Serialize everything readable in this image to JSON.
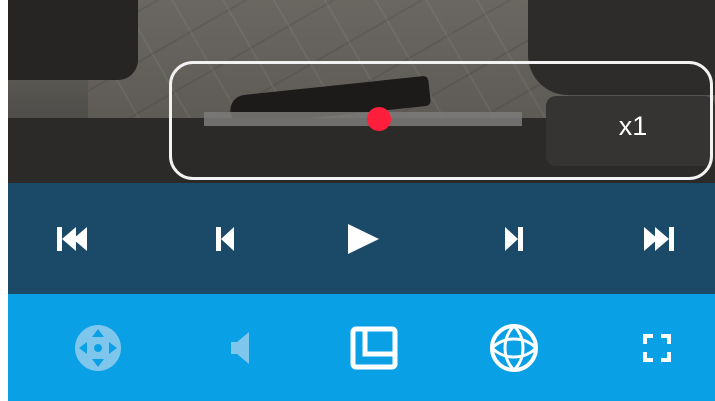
{
  "player": {
    "speed_label": "x1",
    "seek_position": 0.55
  },
  "transport": {
    "buttons": [
      "skip-to-start",
      "previous-frame",
      "play",
      "next-frame",
      "skip-to-end"
    ]
  },
  "toolbar": {
    "buttons": [
      "ptz-control",
      "audio",
      "layout",
      "fisheye",
      "fullscreen"
    ]
  },
  "colors": {
    "transport_bg": "#1b4a68",
    "toolbar_bg": "#0aa0e6",
    "seek_thumb": "#ff1e3c",
    "icon_white": "#ffffff",
    "icon_inactive": "#7fc6ec"
  }
}
